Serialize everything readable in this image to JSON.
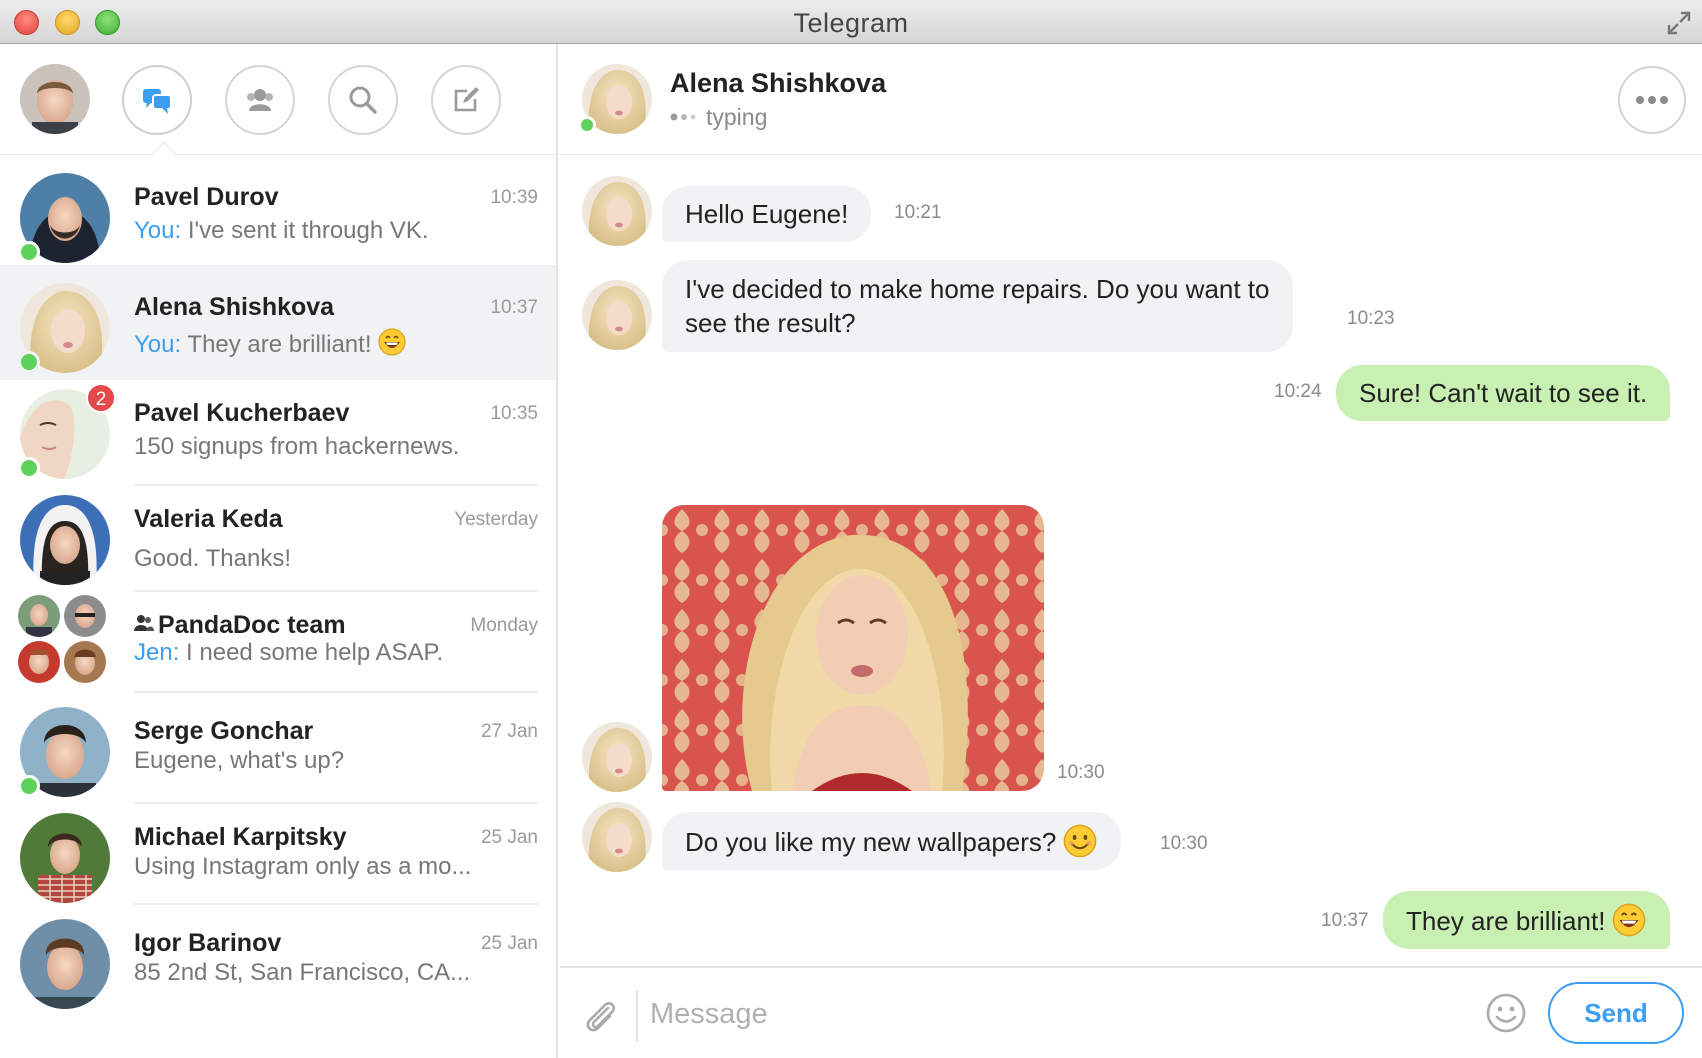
{
  "window": {
    "title": "Telegram"
  },
  "colors": {
    "accent": "#3a9ef3",
    "online": "#5cd25a",
    "badge": "#e4484a",
    "out_bubble": "#c9f0b3",
    "in_bubble": "#f1f2f4"
  },
  "toolbar": {
    "buttons": [
      {
        "name": "chats",
        "icon": "chat-bubbles-icon",
        "active": true
      },
      {
        "name": "contacts",
        "icon": "contacts-icon"
      },
      {
        "name": "search",
        "icon": "search-icon"
      },
      {
        "name": "compose",
        "icon": "compose-icon"
      }
    ]
  },
  "chats": [
    {
      "name": "Pavel Durov",
      "time": "10:39",
      "sender": "You:",
      "preview": " I've sent it through VK.",
      "online": true
    },
    {
      "name": "Alena Shishkova",
      "time": "10:37",
      "sender": "You:",
      "preview": " They are brilliant!",
      "emoji": "grinning-face",
      "online": true,
      "selected": true
    },
    {
      "name": "Pavel Kucherbaev",
      "time": "10:35",
      "preview": "150 signups from hackernews.",
      "online": true,
      "unread": "2"
    },
    {
      "name": "Valeria Keda",
      "time": "Yesterday",
      "preview": "Good. Thanks!"
    },
    {
      "name": "PandaDoc team",
      "time": "Monday",
      "sender": "Jen:",
      "preview": " I need some help ASAP.",
      "group": true
    },
    {
      "name": "Serge Gonchar",
      "time": "27 Jan",
      "preview": "Eugene, what's up?",
      "online": true
    },
    {
      "name": "Michael Karpitsky",
      "time": "25 Jan",
      "preview": "Using Instagram only as a mo..."
    },
    {
      "name": "Igor Barinov",
      "time": "25 Jan",
      "preview": "85 2nd St, San Francisco, CA..."
    }
  ],
  "conversation": {
    "name": "Alena Shishkova",
    "status": "typing",
    "messages": [
      {
        "direction": "in",
        "text": "Hello Eugene!",
        "time": "10:21"
      },
      {
        "direction": "in",
        "text_line1": "I've decided to make home repairs. Do you want to",
        "text_line2": "see the result?",
        "time": "10:23"
      },
      {
        "direction": "out",
        "text": "Sure! Can't wait to see it.",
        "time": "10:24"
      },
      {
        "direction": "in",
        "type": "photo",
        "time": "10:30"
      },
      {
        "direction": "in",
        "text": "Do you like my new wallpapers?",
        "emoji": "smiling-face",
        "time": "10:30"
      },
      {
        "direction": "out",
        "text": "They are brilliant!",
        "emoji": "grinning-face",
        "time": "10:37"
      }
    ]
  },
  "composer": {
    "placeholder": "Message",
    "send_label": "Send"
  }
}
